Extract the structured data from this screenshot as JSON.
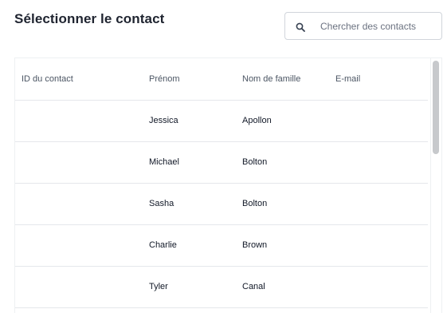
{
  "header": {
    "title": "Sélectionner le contact"
  },
  "search": {
    "placeholder": "Chercher des contacts",
    "value": "",
    "icon": "search-icon"
  },
  "table": {
    "columns": [
      "ID du contact",
      "Prénom",
      "Nom de famille",
      "E-mail"
    ],
    "rows": [
      {
        "id": "",
        "first_name": "Jessica",
        "last_name": "Apollon",
        "email": ""
      },
      {
        "id": "",
        "first_name": "Michael",
        "last_name": "Bolton",
        "email": ""
      },
      {
        "id": "",
        "first_name": "Sasha",
        "last_name": "Bolton",
        "email": ""
      },
      {
        "id": "",
        "first_name": "Charlie",
        "last_name": "Brown",
        "email": ""
      },
      {
        "id": "",
        "first_name": "Tyler",
        "last_name": "Canal",
        "email": ""
      }
    ]
  },
  "colors": {
    "border": "#d1d5db",
    "row_divider": "#e5e7eb",
    "scrollbar_thumb": "#c7c9cc",
    "text_primary": "#111827",
    "text_header": "#4b5563"
  }
}
